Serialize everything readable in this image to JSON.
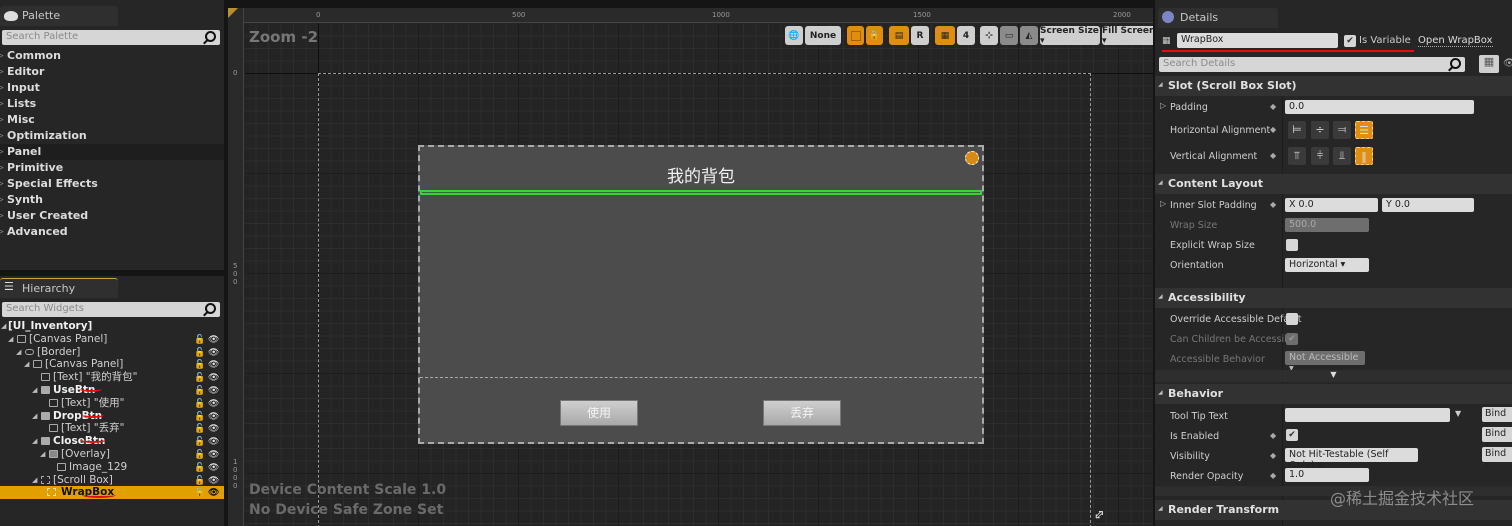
{
  "palette": {
    "tab_label": "Palette",
    "search_placeholder": "Search Palette",
    "categories": [
      "Common",
      "Editor",
      "Input",
      "Lists",
      "Misc",
      "Optimization",
      "Panel",
      "Primitive",
      "Special Effects",
      "Synth",
      "User Created",
      "Advanced"
    ],
    "highlighted": "Panel"
  },
  "hierarchy": {
    "tab_label": "Hierarchy",
    "search_placeholder": "Search Widgets",
    "nodes": [
      {
        "label": "[UI_Inventory]",
        "depth": 0
      },
      {
        "label": "[Canvas Panel]",
        "depth": 1
      },
      {
        "label": "[Border]",
        "depth": 2
      },
      {
        "label": "[Canvas Panel]",
        "depth": 3
      },
      {
        "label": "[Text] \"我的背包\"",
        "depth": 4
      },
      {
        "label": "UseBtn",
        "depth": 3
      },
      {
        "label": "[Text] \"使用\"",
        "depth": 4
      },
      {
        "label": "DropBtn",
        "depth": 3
      },
      {
        "label": "[Text] \"丢弃\"",
        "depth": 4
      },
      {
        "label": "CloseBtn",
        "depth": 3
      },
      {
        "label": "[Overlay]",
        "depth": 4
      },
      {
        "label": "Image_129",
        "depth": 5
      },
      {
        "label": "[Scroll Box]",
        "depth": 3
      },
      {
        "label": "WrapBox",
        "depth": 4
      }
    ],
    "selected": "WrapBox"
  },
  "viewport": {
    "zoom_label": "Zoom -2",
    "ruler_top": [
      "0",
      "500",
      "1000",
      "1500",
      "2000"
    ],
    "ruler_left": [
      "0",
      "500",
      "1000"
    ],
    "toolbar": {
      "localize": "None",
      "grid_snap": "4",
      "screen_size": "Screen Size",
      "fill_screen": "Fill Screen",
      "r_label": "R"
    },
    "info_lines": [
      "Device Content Scale 1.0",
      "No Device Safe Zone Set"
    ],
    "widget": {
      "title": "我的背包",
      "use_button": "使用",
      "drop_button": "丢弃"
    }
  },
  "details": {
    "tab_label": "Details",
    "widget_name": "WrapBox",
    "is_variable_label": "Is Variable",
    "is_variable": true,
    "open_link": "Open WrapBox",
    "search_placeholder": "Search Details",
    "sections": {
      "slot": "Slot (Scroll Box Slot)",
      "content_layout": "Content Layout",
      "accessibility": "Accessibility",
      "behavior": "Behavior",
      "render_transform": "Render Transform"
    },
    "props": {
      "padding_label": "Padding",
      "padding_value": "0.0",
      "halign_label": "Horizontal Alignment",
      "valign_label": "Vertical Alignment",
      "inner_slot_padding_label": "Inner Slot Padding",
      "inner_x": "X  0.0",
      "inner_y": "Y  0.0",
      "wrap_size_label": "Wrap Size",
      "wrap_size_value": "500.0",
      "explicit_wrap_label": "Explicit Wrap Size",
      "orientation_label": "Orientation",
      "orientation_value": "Horizontal",
      "override_acc_label": "Override Accessible Default",
      "children_acc_label": "Can Children be Accessible",
      "acc_behavior_label": "Accessible Behavior",
      "acc_behavior_value": "Not Accessible",
      "tooltip_label": "Tool Tip Text",
      "tooltip_value": "",
      "enabled_label": "Is Enabled",
      "visibility_label": "Visibility",
      "visibility_value": "Not Hit-Testable (Self Only)",
      "opacity_label": "Render Opacity",
      "opacity_value": "1.0",
      "bind_label": "Bind"
    }
  },
  "watermark": "@稀土掘金技术社区"
}
